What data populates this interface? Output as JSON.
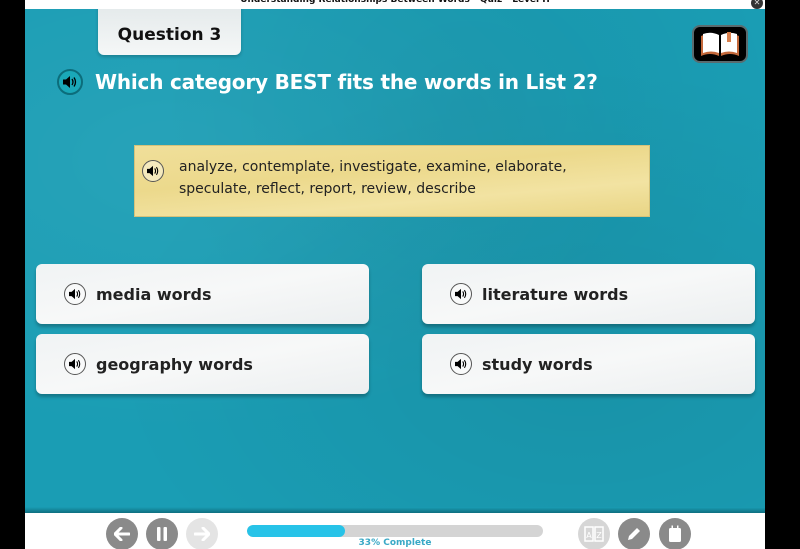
{
  "window": {
    "title": "Understanding Relationships Between Words - Quiz - Level H",
    "close_icon": "close-circle-icon"
  },
  "header": {
    "question_label": "Question 3",
    "glossary_icon": "open-book-icon"
  },
  "prompt": {
    "text": "Which category BEST fits the words in List 2?",
    "audio_icon": "speaker-icon"
  },
  "word_list": {
    "text": "analyze, contemplate, investigate, examine, elaborate, speculate, reflect, report, review, describe",
    "audio_icon": "speaker-icon"
  },
  "answers": [
    {
      "label": "media words"
    },
    {
      "label": "literature words"
    },
    {
      "label": "geography words"
    },
    {
      "label": "study words"
    }
  ],
  "footer": {
    "progress_percent": 33,
    "progress_label": "33% Complete",
    "buttons": {
      "back": "arrow-left-icon",
      "pause": "pause-icon",
      "next": "arrow-right-icon",
      "dictionary": "a-z-dictionary-icon",
      "pencil": "pencil-icon",
      "notepad": "notepad-icon"
    }
  },
  "colors": {
    "stage_bg": "#1a9db4",
    "word_list_bg": "#ecd98c",
    "progress_fill": "#27c3e8",
    "progress_label": "#3aa9c6"
  }
}
